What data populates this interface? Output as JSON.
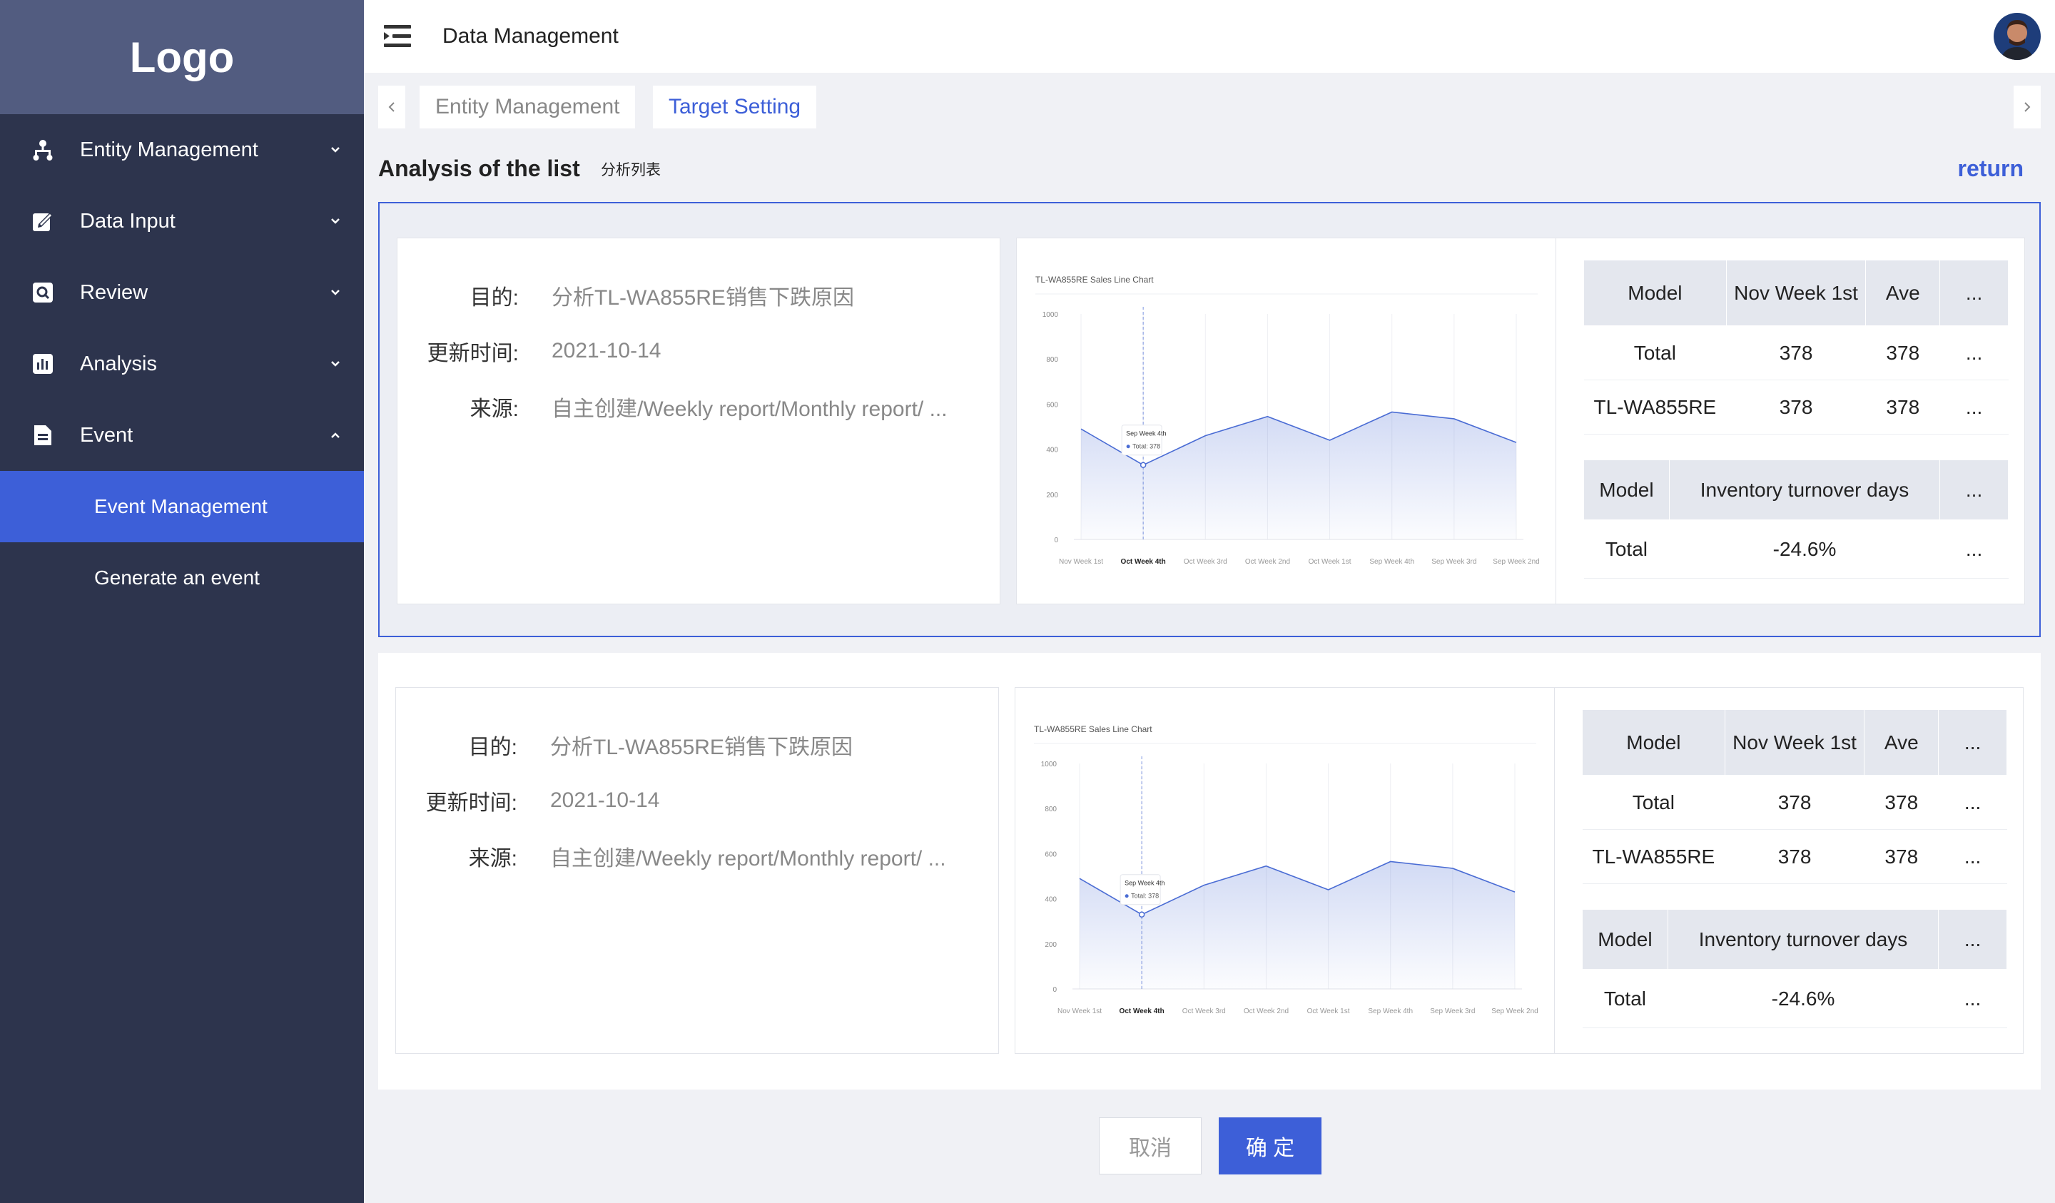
{
  "sidebar": {
    "logo": "Logo",
    "items": [
      {
        "label": "Entity Management",
        "icon": "hierarchy-icon",
        "expanded": false
      },
      {
        "label": "Data Input",
        "icon": "edit-icon",
        "expanded": false
      },
      {
        "label": "Review",
        "icon": "search-icon",
        "expanded": false
      },
      {
        "label": "Analysis",
        "icon": "bar-chart-icon",
        "expanded": false
      },
      {
        "label": "Event",
        "icon": "document-icon",
        "expanded": true
      }
    ],
    "sub_items": [
      {
        "label": "Event Management",
        "active": true
      },
      {
        "label": "Generate an event",
        "active": false
      }
    ]
  },
  "header": {
    "title": "Data Management"
  },
  "tabs": [
    {
      "label": "Entity Management",
      "active": false
    },
    {
      "label": "Target Setting",
      "active": true
    }
  ],
  "section": {
    "title": "Analysis of the list",
    "subtitle": "分析列表",
    "return_label": "return"
  },
  "cards": [
    {
      "selected": true,
      "info": [
        {
          "label": "目的:",
          "value": "分析TL-WA855RE销售下跌原因"
        },
        {
          "label": "更新时间:",
          "value": "2021-10-14"
        },
        {
          "label": "来源:",
          "value": "自主创建/Weekly report/Monthly report/ ..."
        }
      ],
      "table1": {
        "headers": [
          "Model",
          "Nov Week 1st",
          "Ave",
          "..."
        ],
        "rows": [
          [
            "Total",
            "378",
            "378",
            "..."
          ],
          [
            "TL-WA855RE",
            "378",
            "378",
            "..."
          ]
        ]
      },
      "table2": {
        "headers": [
          "Model",
          "Inventory turnover days",
          "..."
        ],
        "rows": [
          [
            "Total",
            "-24.6%",
            "..."
          ]
        ]
      }
    },
    {
      "selected": false,
      "info": [
        {
          "label": "目的:",
          "value": "分析TL-WA855RE销售下跌原因"
        },
        {
          "label": "更新时间:",
          "value": "2021-10-14"
        },
        {
          "label": "来源:",
          "value": "自主创建/Weekly report/Monthly report/ ..."
        }
      ],
      "table1": {
        "headers": [
          "Model",
          "Nov Week 1st",
          "Ave",
          "..."
        ],
        "rows": [
          [
            "Total",
            "378",
            "378",
            "..."
          ],
          [
            "TL-WA855RE",
            "378",
            "378",
            "..."
          ]
        ]
      },
      "table2": {
        "headers": [
          "Model",
          "Inventory turnover days",
          "..."
        ],
        "rows": [
          [
            "Total",
            "-24.6%",
            "..."
          ]
        ]
      }
    }
  ],
  "chart_data": [
    {
      "type": "area",
      "title": "TL-WA855RE Sales Line Chart",
      "categories": [
        "Nov Week 1st",
        "Oct Week 4th",
        "Oct Week 3rd",
        "Oct Week 2nd",
        "Oct Week 1st",
        "Sep Week 4th",
        "Sep Week 3rd",
        "Sep Week 2nd"
      ],
      "series": [
        {
          "name": "Total",
          "values": [
            490,
            330,
            460,
            545,
            440,
            565,
            535,
            430
          ]
        }
      ],
      "yticks": [
        "1000",
        "800",
        "600",
        "400",
        "200",
        "0"
      ],
      "ylim": [
        0,
        1000
      ],
      "grid": true,
      "tooltip": {
        "category": "Sep Week 4th",
        "label": "Total",
        "value": "378"
      },
      "highlight_index": 1,
      "accent": "#4a6cd4"
    },
    {
      "type": "area",
      "title": "TL-WA855RE Sales Line Chart",
      "categories": [
        "Nov Week 1st",
        "Oct Week 4th",
        "Oct Week 3rd",
        "Oct Week 2nd",
        "Oct Week 1st",
        "Sep Week 4th",
        "Sep Week 3rd",
        "Sep Week 2nd"
      ],
      "series": [
        {
          "name": "Total",
          "values": [
            490,
            330,
            460,
            545,
            440,
            565,
            535,
            430
          ]
        }
      ],
      "yticks": [
        "1000",
        "800",
        "600",
        "400",
        "200",
        "0"
      ],
      "ylim": [
        0,
        1000
      ],
      "grid": true,
      "tooltip": {
        "category": "Sep Week 4th",
        "label": "Total",
        "value": "378"
      },
      "highlight_index": 1,
      "accent": "#4a6cd4"
    }
  ],
  "buttons": {
    "cancel": "取消",
    "confirm": "确 定"
  },
  "colors": {
    "sidebar": "#2d344d",
    "logo_bg": "#525c80",
    "accent": "#3d5fd8"
  }
}
